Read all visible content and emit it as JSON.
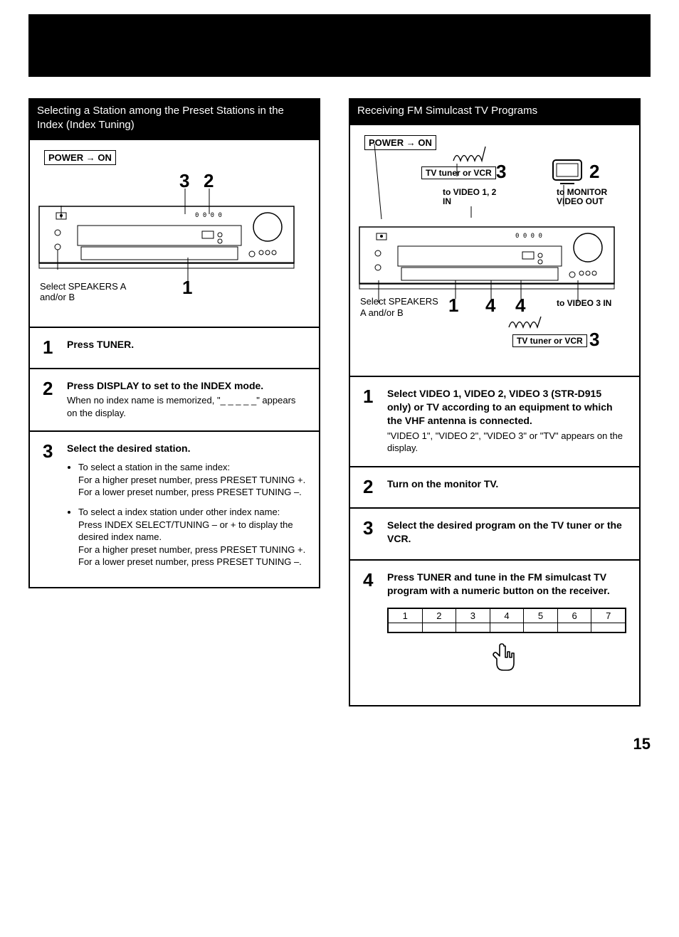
{
  "page_number": "15",
  "left": {
    "title": "Selecting a Station among the Preset Stations in the Index (Index Tuning)",
    "diagram": {
      "power_label": "POWER → ON",
      "callout_3": "3",
      "callout_2": "2",
      "callout_1": "1",
      "caption": "Select SPEAKERS A and/or B"
    },
    "steps": [
      {
        "num": "1",
        "head": "Press TUNER."
      },
      {
        "num": "2",
        "head": "Press DISPLAY to set to the INDEX mode.",
        "body": "When no index name is memorized, \"_ _ _ _ _\" appears on the display."
      },
      {
        "num": "3",
        "head": "Select the desired station.",
        "bullets": [
          "To select a station in the same index:\nFor a higher preset number, press PRESET TUNING +.\nFor a lower preset number, press PRESET TUNING –.",
          "To select a index station under other index name:\nPress INDEX SELECT/TUNING – or + to display the desired index name.\nFor a higher preset number, press PRESET TUNING +.\nFor a lower preset number, press PRESET TUNING –."
        ]
      }
    ]
  },
  "right": {
    "title": "Receiving FM Simulcast TV Programs",
    "diagram": {
      "power_label": "POWER → ON",
      "tv_vcr_top_label": "TV tuner or VCR",
      "tv_vcr_bottom_label": "TV tuner or VCR",
      "callout_top_3": "3",
      "callout_top_2": "2",
      "callout_mid_1": "1",
      "callout_mid_4a": "4",
      "callout_mid_4b": "4",
      "callout_bot_3": "3",
      "to_video12_in": "to VIDEO 1, 2 IN",
      "to_monitor_out": "to MONITOR VIDEO OUT",
      "to_video3_in": "to VIDEO 3 IN",
      "caption": "Select SPEAKERS A and/or B"
    },
    "steps": [
      {
        "num": "1",
        "head": "Select VIDEO 1, VIDEO 2, VIDEO 3 (STR-D915 only) or TV according to an equipment to which the VHF antenna is connected.",
        "body": "\"VIDEO 1\", \"VIDEO 2\", \"VIDEO 3\" or \"TV\" appears on the display."
      },
      {
        "num": "2",
        "head": "Turn on the monitor TV."
      },
      {
        "num": "3",
        "head": "Select the desired program on the TV tuner or the VCR."
      },
      {
        "num": "4",
        "head": "Press TUNER and tune in the FM simulcast TV program with a numeric button on the receiver.",
        "numstrip": [
          "1",
          "2",
          "3",
          "4",
          "5",
          "6",
          "7"
        ]
      }
    ]
  }
}
